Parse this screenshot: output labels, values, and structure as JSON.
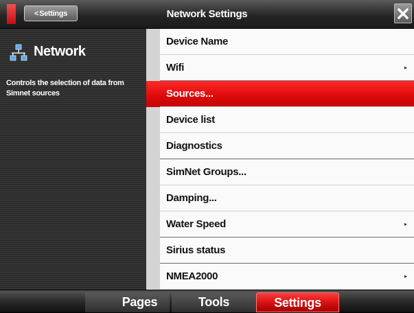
{
  "header": {
    "back_label": "Settings",
    "title": "Network Settings",
    "close_icon": "close-icon"
  },
  "side_panel": {
    "icon": "network-icon",
    "title": "Network",
    "description": "Controls the selection of data from Simnet sources"
  },
  "menu": {
    "items": [
      {
        "label": "Device Name",
        "has_submenu": false
      },
      {
        "label": "Wifi",
        "has_submenu": true
      },
      {
        "label": "Sources...",
        "has_submenu": false,
        "selected": true
      },
      {
        "label": "Device list",
        "has_submenu": false
      },
      {
        "label": "Diagnostics",
        "has_submenu": false
      },
      {
        "label": "SimNet Groups...",
        "has_submenu": false
      },
      {
        "label": "Damping...",
        "has_submenu": false
      },
      {
        "label": "Water Speed",
        "has_submenu": true
      },
      {
        "label": "Sirius status",
        "has_submenu": false
      },
      {
        "label": "NMEA2000",
        "has_submenu": true
      }
    ],
    "submenu_icon": "▸"
  },
  "bottom_tabs": {
    "pages": "Pages",
    "tools": "Tools",
    "settings": "Settings",
    "active": "Settings"
  },
  "colors": {
    "accent_red": "#e00b0b",
    "menu_background": "#fafafa",
    "panel_background": "#333333"
  }
}
